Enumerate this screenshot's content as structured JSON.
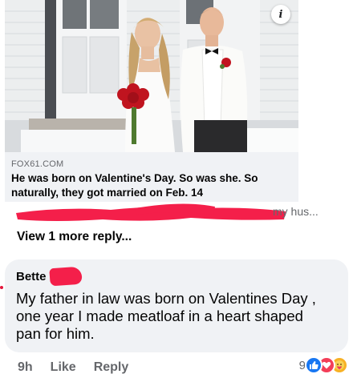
{
  "link_card": {
    "source": "FOX61.COM",
    "headline": "He was born on Valentine's Day. So was she. So naturally, they got married on Feb. 14",
    "info_glyph": "i"
  },
  "truncated_reply": {
    "text": "my hus..."
  },
  "view_more": "View 1 more reply...",
  "comment": {
    "author": "Bette",
    "body": "My father in law was born on Valentines Day , one year I made meatloaf in a heart shaped pan for him."
  },
  "actions": {
    "time": "9h",
    "like": "Like",
    "reply": "Reply"
  },
  "reactions": {
    "count": "9",
    "icons": [
      "like-icon",
      "love-icon",
      "care-icon"
    ]
  },
  "colors": {
    "redaction": "#f41f4a",
    "like_blue": "#1877f2",
    "love_red": "#f33e58",
    "care_yellow": "#f7b125",
    "bubble_bg": "#f0f2f5"
  }
}
